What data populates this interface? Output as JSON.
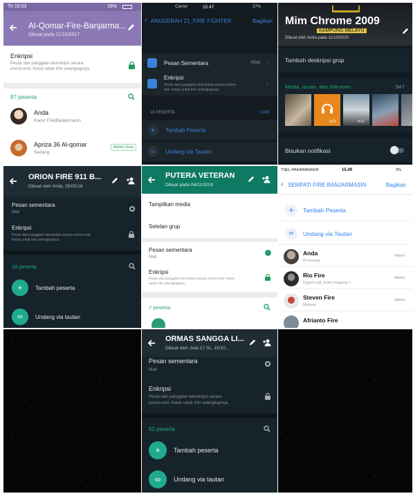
{
  "p1": {
    "status_time": "Tri 10:03",
    "status_right": "18%",
    "title": "Al-Qomar-Fire-Banjarma...",
    "subtitle": "Dibuat pada 11/10/2017",
    "enc_title": "Enkripsi",
    "enc_desc1": "Pesan dan panggilan terenkripsi secara",
    "enc_desc2": "end-to-end. Ketuk untuk info selengkapnya.",
    "count": "87 peserta",
    "m1_name": "Anda",
    "m1_status": "Kacer Fire|Banjarmasin",
    "m2_name": "Apriza 36 Al-qomar",
    "m2_status": "Sedang",
    "m2_badge": "Admin Grup",
    "colors": {
      "header": "#8b78b5",
      "teal": "#2a9d78",
      "green": "#1e9a5c"
    }
  },
  "p2": {
    "status_left": "Carrier",
    "status_time": "15.47",
    "status_right": "27%",
    "back": "ANUGERAH 21_FIRE FIGHTER",
    "share": "Bagikan",
    "r1": "Pesan Sementara",
    "r1_val": "Mati",
    "r2": "Enkripsi",
    "r2_desc1": "Pesan dan panggilan terenkripsi secara end-to-",
    "r2_desc2": "end. Ketuk untuk info selengkapnya.",
    "count": "18 PESERTA",
    "search": "CARI",
    "add": "Tambah Peserta",
    "invite": "Undang via Tautan",
    "colors": {
      "bg": "#131a20",
      "blue": "#3b82d9"
    }
  },
  "p3": {
    "title": "Mim Chrome 2009",
    "banner": "KAMPUNG MELAYU",
    "subtitle": "Dibuat oleh Anda pada 11/10/2020",
    "desc": "Tambah deskripsi grup",
    "media": "Media, tautan, dan dokumen",
    "media_count": "547",
    "thumb_dur1": "0:03",
    "thumb_dur2": "0:12",
    "mute": "Bisukan notifikasi",
    "colors": {
      "bg": "#111b21",
      "green": "#21a66b",
      "orange": "#e8871e"
    }
  },
  "p4": {
    "title": "ORION FIRE 911 B...",
    "subtitle": "Dibuat oleh Anda, 25/05/18",
    "r1": "Pesan sementara",
    "r1_val": "Mati",
    "r2": "Enkripsi",
    "r2_desc1": "Pesan dan panggilan terenkripsi secara end-to-end.",
    "r2_desc2": "Ketuk untuk info selengkapnya.",
    "count": "28 peserta",
    "add": "Tambah peserta",
    "invite": "Undang via tautan",
    "colors": {
      "bg": "#17232b",
      "teal": "#1faa8f"
    }
  },
  "p5": {
    "title": "PUTERA VETERAN",
    "subtitle": "Dibuat pada 04/11/2019",
    "r1": "Tampilkan media",
    "r2": "Setelan grup",
    "r3": "Pesan sementara",
    "r3_val": "Mati",
    "r4": "Enkripsi",
    "r4_desc1": "Pesan dan panggilan terenkripsi secara end-to-end. Ketuk",
    "r4_desc2": "untuk info selengkapnya.",
    "count": "7 peserta",
    "colors": {
      "header": "#0e7a64",
      "teal": "#2a9d78"
    }
  },
  "p6": {
    "status_left": "TSEL-PAKAIMASKER",
    "status_time": "15.49",
    "status_right": "3%",
    "back": "SEMPATI FIRE BANJARMASIN",
    "share": "Bagikan",
    "add": "Tambah Peserta",
    "invite": "Undang via Tautan",
    "members": [
      {
        "name": "Anda",
        "status": "Di senang",
        "badge": "Admin"
      },
      {
        "name": "Rio Fire",
        "status": "Urgent call, tunter lengang !!",
        "badge": "Admin"
      },
      {
        "name": "Steven Fire",
        "status": "Melawa",
        "badge": "Admin"
      },
      {
        "name": "Afrianto Fire",
        "status": "",
        "badge": ""
      }
    ],
    "colors": {
      "blue": "#2f80ed"
    }
  },
  "p7": {
    "title": "ORMAS SANGGA LI...",
    "subtitle": "Dibuat oleh Jelal 17 SL, 15/10...",
    "r1": "Pesan sementara",
    "r1_val": "Mati",
    "r2": "Enkripsi",
    "r2_desc1": "Pesan dan panggilan terenkripsi secara",
    "r2_desc2": "end-to-end. Ketuk untuk info selengkapnya.",
    "count": "52 peserta",
    "add": "Tambah peserta",
    "invite": "Undang via tautan",
    "colors": {
      "bg": "#17232b",
      "teal": "#1faa8f"
    }
  }
}
